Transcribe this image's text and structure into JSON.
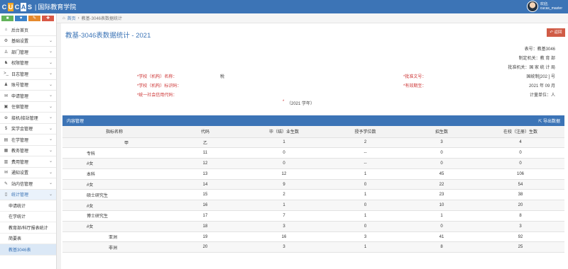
{
  "header": {
    "logo_letters": [
      "C",
      "U",
      "C",
      "A",
      "S"
    ],
    "logo_separator": "|",
    "logo_subtitle": "国际教育学院",
    "user_greeting": "欢迎,",
    "user_name": "cucas_master"
  },
  "quick_buttons": [
    {
      "label": "■",
      "color": "#63b35a"
    },
    {
      "label": "♥",
      "color": "#3c82c8"
    },
    {
      "label": "✎",
      "color": "#e68a2e"
    },
    {
      "label": "✚",
      "color": "#d85846"
    }
  ],
  "menu": [
    {
      "icon": "⌂",
      "label": "后台首页",
      "arrow": ""
    },
    {
      "icon": "⚙",
      "label": "基础设置",
      "arrow": "⌄"
    },
    {
      "icon": "♙",
      "label": "部门管理",
      "arrow": "⌄"
    },
    {
      "icon": "♞",
      "label": "权限管理",
      "arrow": "⌄"
    },
    {
      "icon": ">_",
      "label": "日志管理",
      "arrow": "⌄"
    },
    {
      "icon": "♟",
      "label": "账号管理",
      "arrow": "⌄"
    },
    {
      "icon": "✉",
      "label": "申请管理",
      "arrow": "⌄"
    },
    {
      "icon": "▣",
      "label": "住宿管理",
      "arrow": "⌄"
    },
    {
      "icon": "⊕",
      "label": "接机/接站管理",
      "arrow": "⌄"
    },
    {
      "icon": "$",
      "label": "奖学金管理",
      "arrow": "⌄"
    },
    {
      "icon": "▤",
      "label": "在学管理",
      "arrow": "⌄"
    },
    {
      "icon": "▦",
      "label": "教务管理",
      "arrow": "⌄"
    },
    {
      "icon": "▥",
      "label": "费用管理",
      "arrow": "⌄"
    },
    {
      "icon": "✉",
      "label": "通知设置",
      "arrow": "⌄"
    },
    {
      "icon": "✎",
      "label": "站内信管理",
      "arrow": "⌄"
    },
    {
      "icon": "▯",
      "label": "统计管理",
      "arrow": "⌄"
    }
  ],
  "submenu": [
    {
      "label": "申请统计"
    },
    {
      "label": "在学统计"
    },
    {
      "label": "教育部/科厅报表统计"
    },
    {
      "label": "简要表"
    },
    {
      "label": "教基3046表",
      "active": true
    }
  ],
  "breadcrumb": {
    "home_icon": "⌂",
    "home": "首页",
    "sep": "›",
    "current": "教基-3046表数据统计"
  },
  "page": {
    "title": "教基-3046表数据统计 - 2021",
    "back_label": "↶ 返回"
  },
  "meta_right": {
    "form_no": "表号：教基3046",
    "org": "制定机关：教 育 部",
    "approval": "批准机关：国 家 统 计 局",
    "approval_no": "*批准文号：",
    "approval_no_val": "国统制[202 ] 号",
    "valid": "*有效期至：",
    "valid_val": "2021 年 09 月",
    "unit": "计量单位：人"
  },
  "meta_left": {
    "school_name": "*学校（机构）名称：",
    "school_name_val": "税",
    "school_code": "*学校（机构）标识码：",
    "credit_code": "*统一社会信用代码："
  },
  "school_year": {
    "star": "*",
    "label": "（2021 学年）"
  },
  "panel": {
    "title": "内容管理",
    "export": "⇱ 导出数据"
  },
  "table": {
    "headers": [
      "指标名称",
      "代码",
      "毕（结）业生数",
      "授予学位数",
      "招生数",
      "在校（注册）生数"
    ],
    "rows": [
      [
        "甲",
        "",
        "乙",
        "1",
        "2",
        "3",
        "4"
      ],
      [
        "专科",
        "",
        "11",
        "0",
        "--",
        "0",
        "0"
      ],
      [
        "#女",
        "",
        "12",
        "0",
        "--",
        "0",
        "0"
      ],
      [
        "本科",
        "",
        "13",
        "12",
        "1",
        "45",
        "106"
      ],
      [
        "#女",
        "",
        "14",
        "9",
        "0",
        "22",
        "54"
      ],
      [
        "硕士研究生",
        "",
        "15",
        "2",
        "1",
        "23",
        "38"
      ],
      [
        "#女",
        "",
        "16",
        "1",
        "0",
        "10",
        "20"
      ],
      [
        "博士研究生",
        "",
        "17",
        "7",
        "1",
        "1",
        "8"
      ],
      [
        "#女",
        "",
        "18",
        "3",
        "0",
        "0",
        "3"
      ],
      [
        "",
        "亚洲",
        "19",
        "16",
        "3",
        "41",
        "92"
      ],
      [
        "",
        "非洲",
        "20",
        "3",
        "1",
        "8",
        "25"
      ]
    ]
  }
}
